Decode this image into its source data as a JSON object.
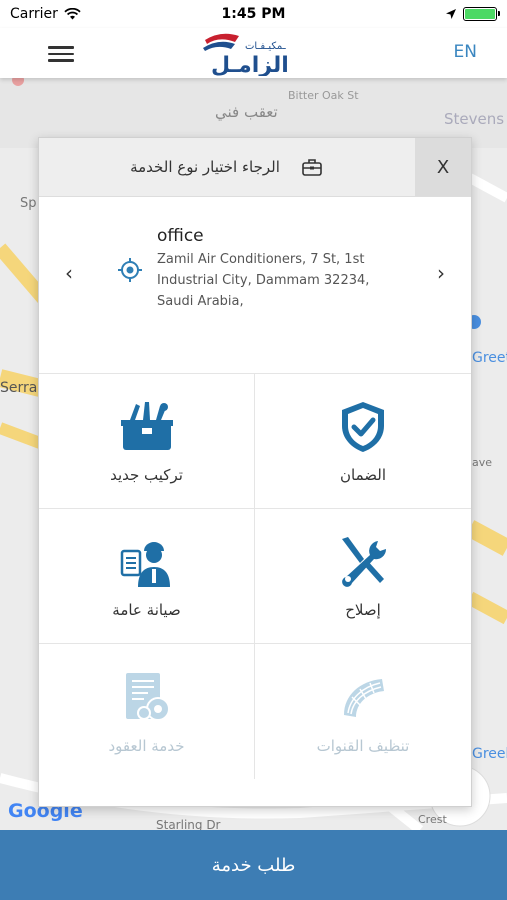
{
  "status": {
    "carrier": "Carrier",
    "time": "1:45 PM"
  },
  "header": {
    "lang_toggle": "EN"
  },
  "map": {
    "labels": {
      "bitter_oak": "Bitter Oak St",
      "taqab": "تعقب فني",
      "stevens": "Stevens",
      "sp": "Sp",
      "serra": "Serra",
      "greet": "Greete",
      "creek": "Greek",
      "starling": "Starling Dr",
      "crest": "Crest",
      "ave": "ave",
      "google": "Google"
    }
  },
  "modal": {
    "title": "الرجاء اختيار نوع الخدمة",
    "close_label": "X",
    "address": {
      "name": "office",
      "text": "Zamil Air Conditioners, 7 St, 1st Industrial City, Dammam 32234, Saudi Arabia,"
    },
    "services": [
      {
        "label": "تركيب جديد",
        "icon": "toolbox-icon",
        "enabled": true
      },
      {
        "label": "الضمان",
        "icon": "shield-check-icon",
        "enabled": true
      },
      {
        "label": "صيانة عامة",
        "icon": "technician-icon",
        "enabled": true
      },
      {
        "label": "إصلاح",
        "icon": "wrench-screwdriver-icon",
        "enabled": true
      },
      {
        "label": "خدمة العقود",
        "icon": "contract-document-icon",
        "enabled": false
      },
      {
        "label": "تنظيف القنوات",
        "icon": "duct-icon",
        "enabled": false
      }
    ]
  },
  "footer": {
    "request_label": "طلب خدمة"
  },
  "colors": {
    "accent": "#3d7db4",
    "icon_blue": "#1f6fa6",
    "disabled_blue": "#bcd6e6"
  }
}
